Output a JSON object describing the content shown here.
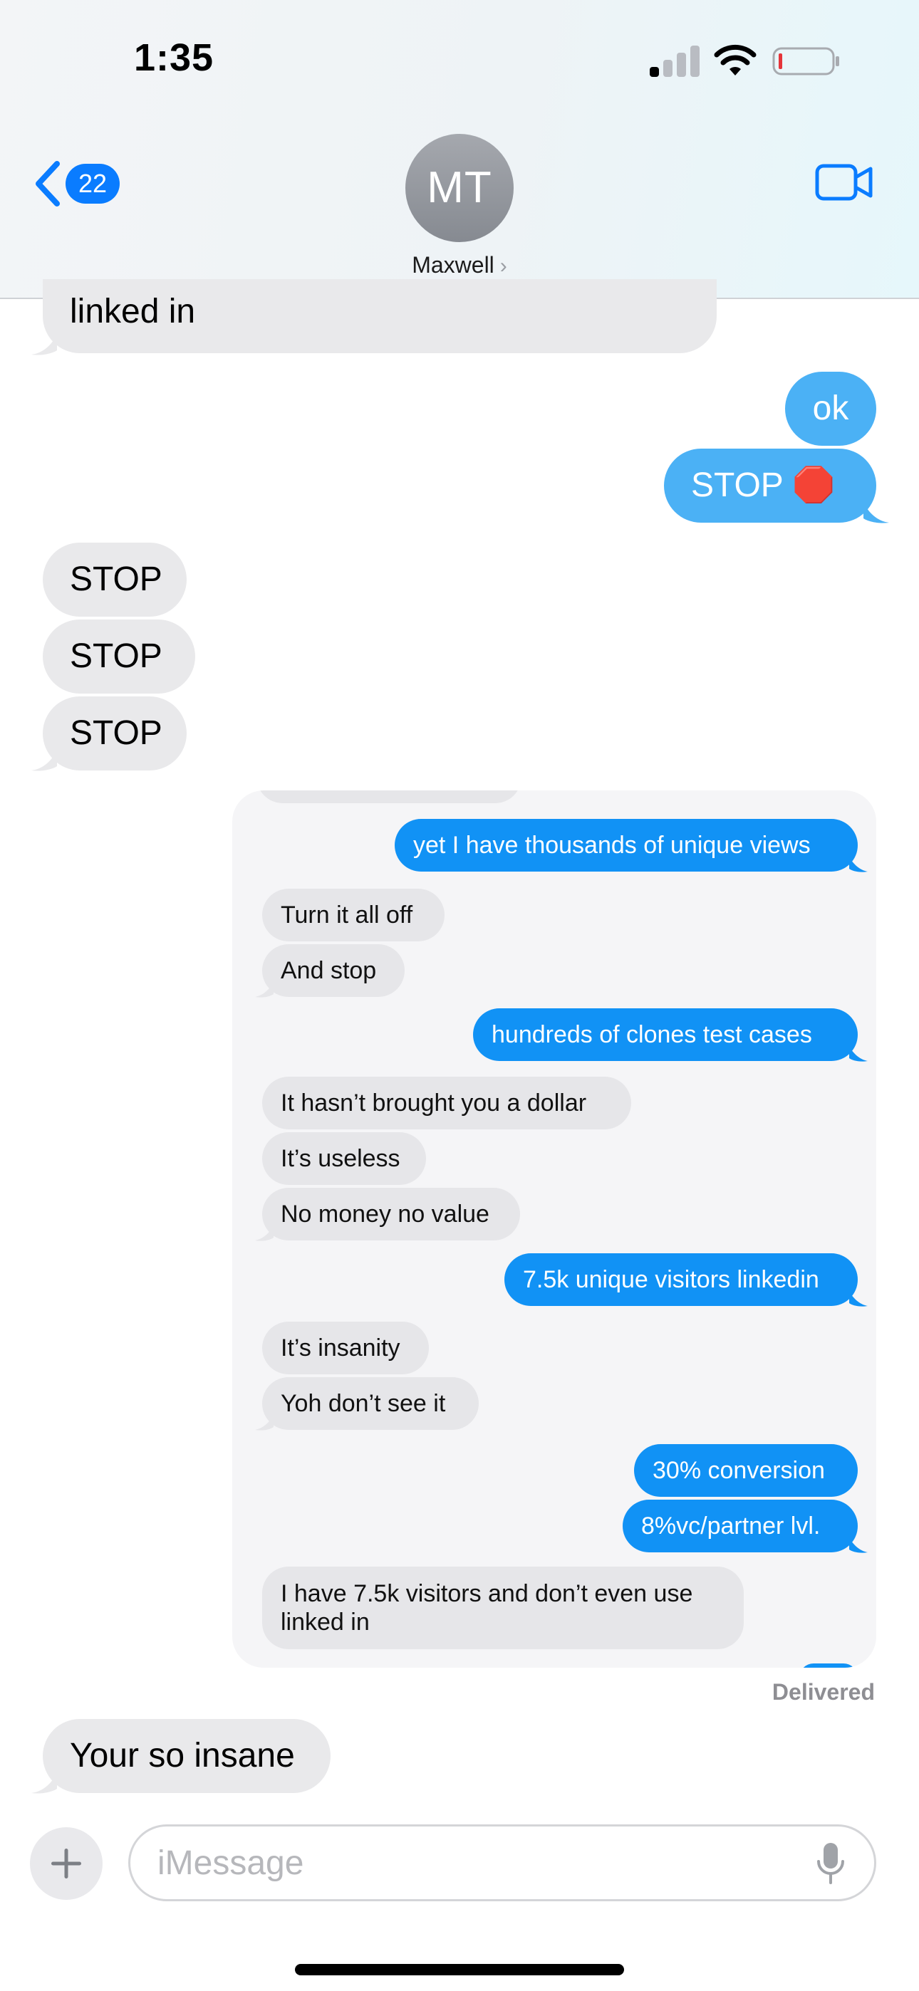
{
  "status_bar": {
    "time": "1:35"
  },
  "header": {
    "back_badge": "22",
    "avatar_initials": "MT",
    "contact_name": "Maxwell",
    "contact_chevron": "›"
  },
  "messages": {
    "m0": "linked in",
    "m1": "ok",
    "m2": "STOP 🛑",
    "m3": "STOP",
    "m4": "STOP",
    "m5": "STOP",
    "m6": "Your so insane"
  },
  "screenshot": {
    "c1": "yet I have thousands of unique views",
    "c2": "Turn it all off",
    "c3": "And stop",
    "c4": "hundreds of clones test cases",
    "c5": "It hasn’t brought you a dollar",
    "c6": "It’s useless",
    "c7": "No money no value",
    "c8": "7.5k unique visitors linkedin",
    "c9": "It’s insanity",
    "c10": "Yoh don’t see it",
    "c11": "30% conversion",
    "c12": "8%vc/partner lvl.",
    "c13": "I have 7.5k visitors and don’t even use linked in"
  },
  "status_delivered": "Delivered",
  "input": {
    "placeholder": "iMessage",
    "value": ""
  },
  "colors": {
    "outgoing": "#4bb1f5",
    "incoming": "#e9e9eb",
    "card_outgoing": "#1192f5",
    "badge": "#0a7cff",
    "accent": "#0a7cff"
  },
  "icons": {
    "back": "chevron-left-icon",
    "video": "video-camera-icon",
    "signal": "cellular-signal-icon",
    "wifi": "wifi-icon",
    "battery": "battery-low-icon",
    "plus": "plus-icon",
    "mic": "microphone-icon"
  }
}
